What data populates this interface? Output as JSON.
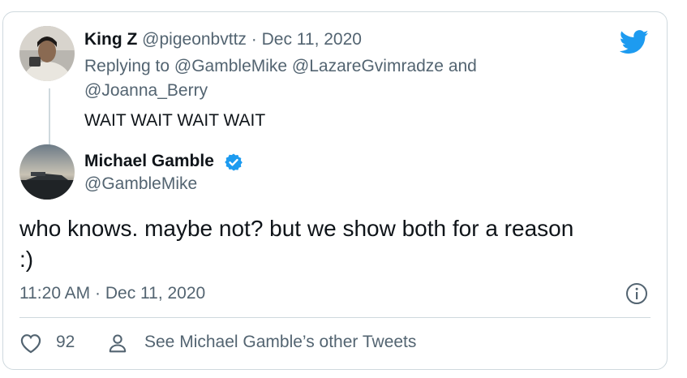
{
  "reply_tweet": {
    "author_name": "King Z",
    "author_handle": "@pigeonbvttz",
    "separator": "·",
    "date": "Dec 11, 2020",
    "replying_prefix": "Replying to",
    "replying_to_line1": "@GambleMike @LazareGvimradze and",
    "replying_to_line2": "@Joanna_Berry",
    "text": "WAIT WAIT WAIT WAIT"
  },
  "main_tweet": {
    "author_name": "Michael Gamble",
    "author_handle": "@GambleMike",
    "text_line1": "who knows. maybe not? but we show both for a reason",
    "text_line2": ":)",
    "time": "11:20 AM",
    "separator": "·",
    "date": "Dec 11, 2020"
  },
  "actions": {
    "like_count": "92",
    "profile_link": "See Michael Gamble’s other Tweets"
  },
  "colors": {
    "twitter_blue": "#1d9bf0",
    "verified": "#1d9bf0",
    "muted": "#536471",
    "border": "#cfd9de"
  },
  "icons": {
    "logo": "twitter-bird-icon",
    "verified": "verified-badge-icon",
    "info": "info-icon",
    "like": "heart-icon",
    "profile": "person-icon"
  }
}
